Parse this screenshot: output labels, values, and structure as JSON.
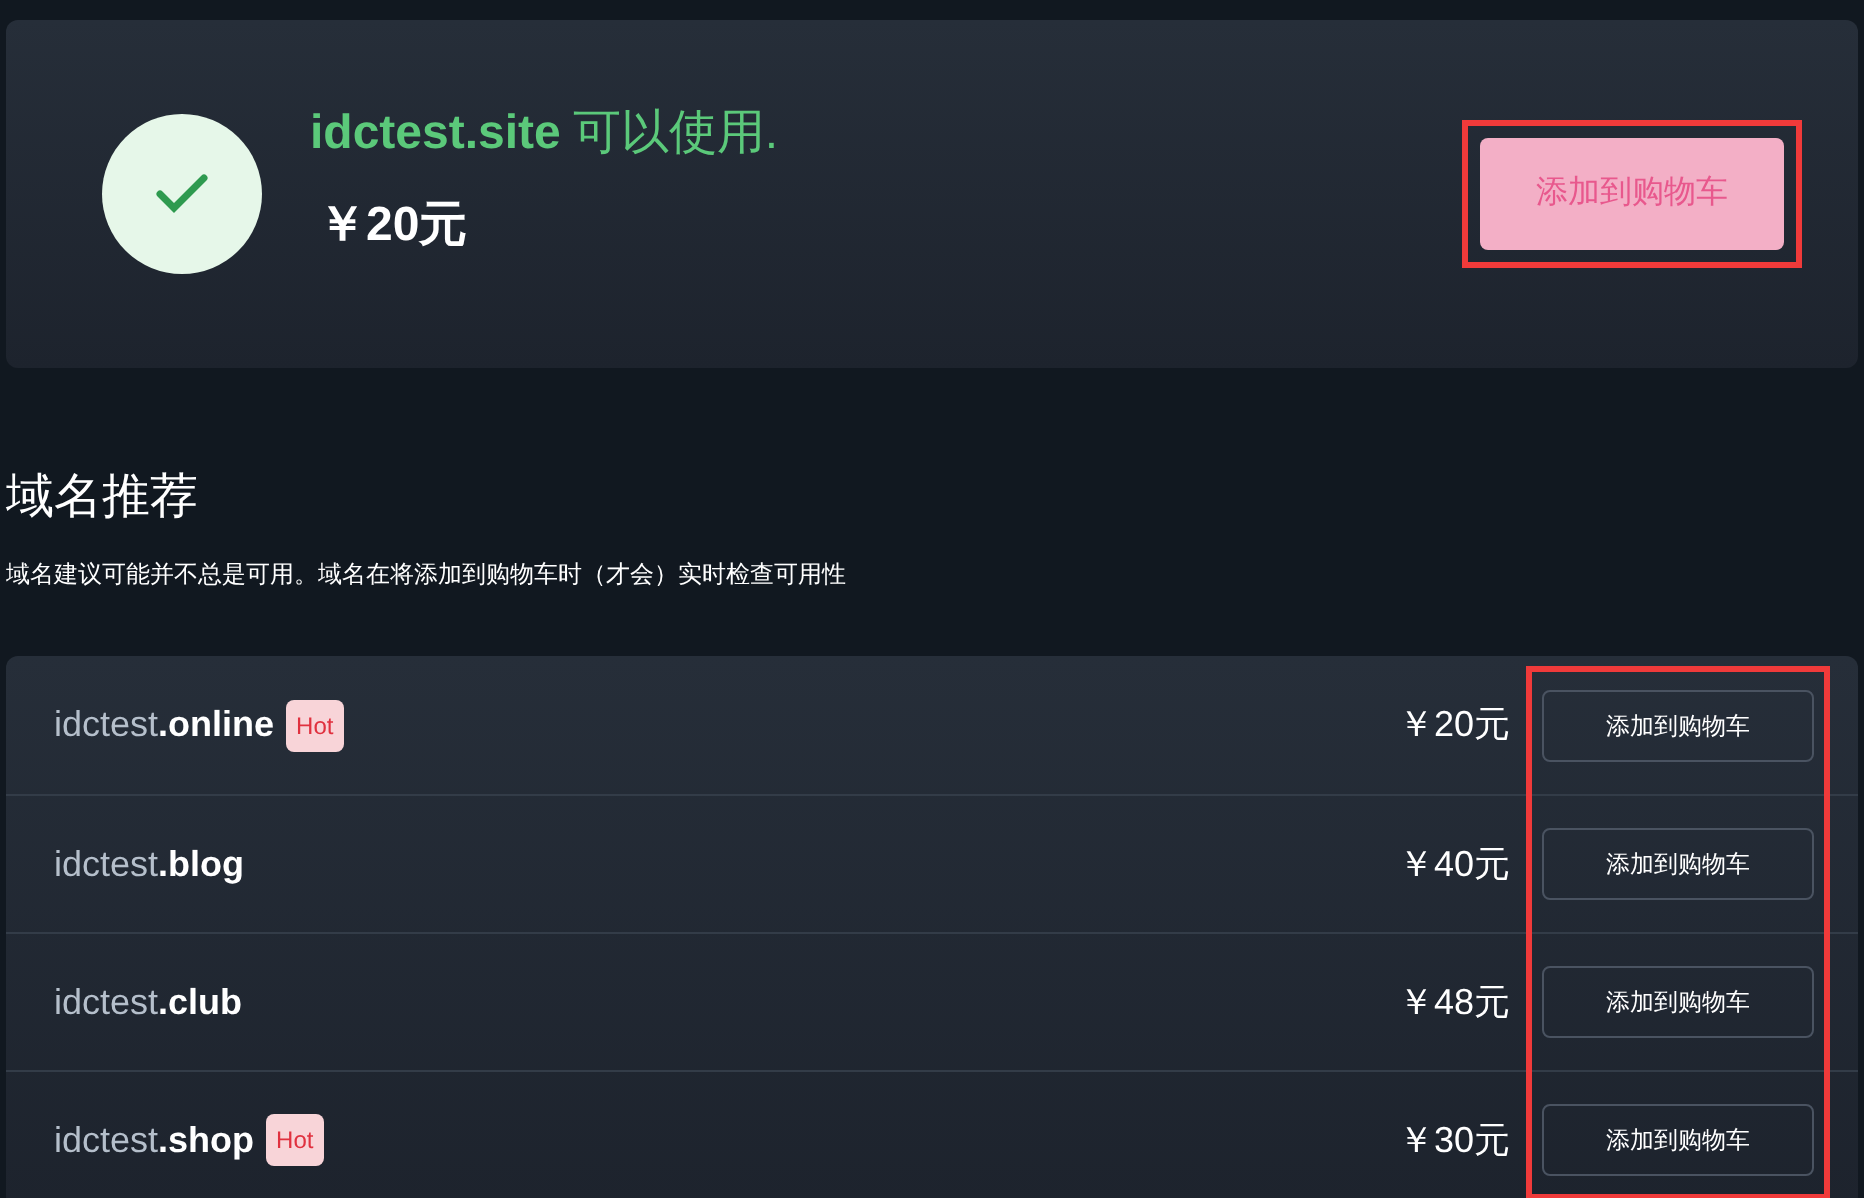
{
  "result": {
    "domain": "idctest.site",
    "status": "可以使用.",
    "available": true,
    "price": "￥20元",
    "button": "添加到购物车",
    "highlighted": true
  },
  "suggestions": {
    "title": "域名推荐",
    "note": "域名建议可能并不总是可用。域名在将添加到购物车时（才会）实时检查可用性",
    "highlighted": true,
    "items": [
      {
        "name": "idctest",
        "tld": ".online",
        "badge": "Hot",
        "price": "￥20元",
        "button": "添加到购物车"
      },
      {
        "name": "idctest",
        "tld": ".blog",
        "price": "￥40元",
        "button": "添加到购物车"
      },
      {
        "name": "idctest",
        "tld": ".club",
        "price": "￥48元",
        "button": "添加到购物车"
      },
      {
        "name": "idctest",
        "tld": ".shop",
        "badge": "Hot",
        "price": "￥30元",
        "button": "添加到购物车"
      }
    ]
  }
}
